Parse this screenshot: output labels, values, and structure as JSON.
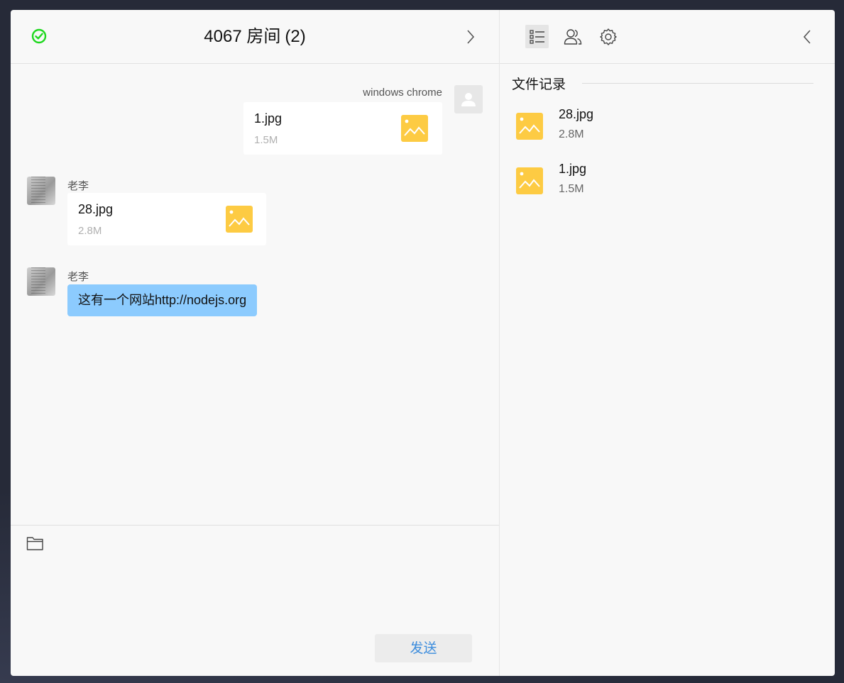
{
  "room": {
    "name": "4067 房间",
    "count": "(2)"
  },
  "messages": [
    {
      "sender": "windows chrome",
      "file_name": "1.jpg",
      "file_size": "1.5M"
    },
    {
      "sender": "老李",
      "file_name": "28.jpg",
      "file_size": "2.8M"
    },
    {
      "sender": "老李",
      "text": "这有一个网站http://nodejs.org"
    }
  ],
  "composer": {
    "send_label": "发送"
  },
  "side": {
    "section_title": "文件记录",
    "records": [
      {
        "name": "28.jpg",
        "size": "2.8M"
      },
      {
        "name": "1.jpg",
        "size": "1.5M"
      }
    ]
  },
  "colors": {
    "online": "#1fd81f",
    "file_icon": "#fdcb43",
    "bubble": "#8ccbfe",
    "send_text": "#3d8ddd"
  }
}
